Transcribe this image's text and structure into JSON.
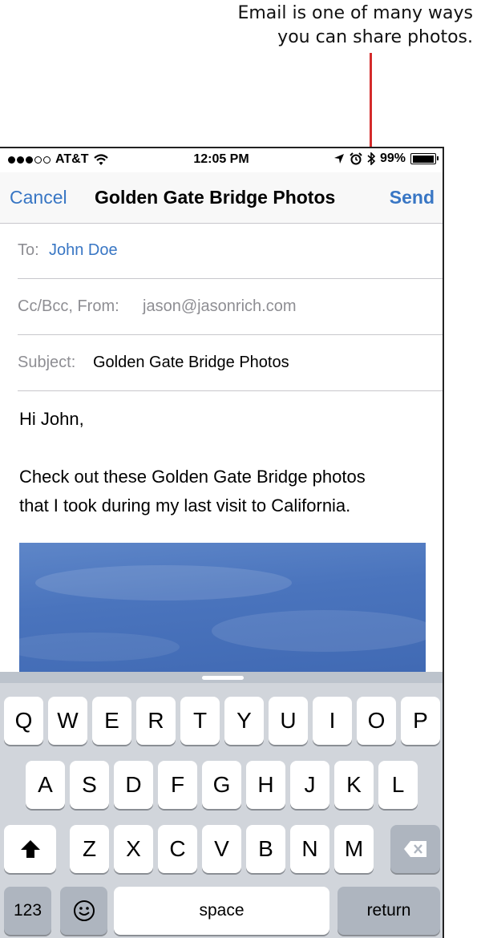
{
  "callout": {
    "line1": "Email is one of many ways",
    "line2": "you can share photos."
  },
  "status_bar": {
    "carrier": "AT&T",
    "time": "12:05 PM",
    "battery": "99%",
    "battery_level": 0.99
  },
  "nav": {
    "cancel_label": "Cancel",
    "title": "Golden Gate Bridge Photos",
    "send_label": "Send"
  },
  "fields": {
    "to_label": "To:",
    "to_value": "John Doe",
    "cc_label": "Cc/Bcc, From:",
    "cc_value": "jason@jasonrich.com",
    "subject_label": "Subject:",
    "subject_value": "Golden Gate Bridge Photos"
  },
  "body": {
    "greeting": "Hi John,",
    "line1": "Check out these Golden Gate Bridge photos",
    "line2": "that I took during my last visit to California."
  },
  "keyboard": {
    "row1": [
      "Q",
      "W",
      "E",
      "R",
      "T",
      "Y",
      "U",
      "I",
      "O",
      "P"
    ],
    "row2": [
      "A",
      "S",
      "D",
      "F",
      "G",
      "H",
      "J",
      "K",
      "L"
    ],
    "row3": [
      "Z",
      "X",
      "C",
      "V",
      "B",
      "N",
      "M"
    ],
    "numbers_label": "123",
    "space_label": "space",
    "return_label": "return",
    "shift_icon": "shift-icon",
    "delete_icon": "delete-icon",
    "emoji_icon": "emoji-icon"
  },
  "colors": {
    "accent": "#3876c4",
    "callout": "#d42b2b"
  }
}
